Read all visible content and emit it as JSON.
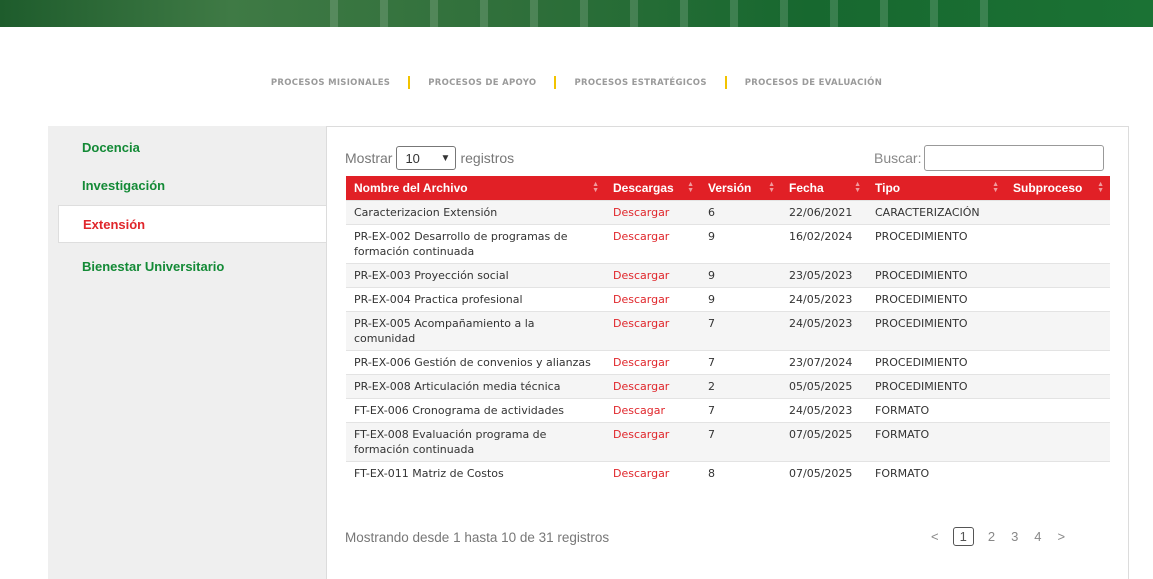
{
  "topnav": [
    "PROCESOS MISIONALES",
    "PROCESOS DE APOYO",
    "PROCESOS ESTRATÉGICOS",
    "PROCESOS DE EVALUACIÓN"
  ],
  "sidebar": {
    "items": [
      {
        "label": "Docencia",
        "active": false
      },
      {
        "label": "Investigación",
        "active": false
      },
      {
        "label": "Extensión",
        "active": true
      },
      {
        "label": "Bienestar Universitario",
        "active": false
      }
    ]
  },
  "controls": {
    "show_label": "Mostrar",
    "page_size": "10",
    "records_label": "registros",
    "search_label": "Buscar:",
    "search_value": ""
  },
  "table": {
    "headers": [
      "Nombre del Archivo",
      "Descargas",
      "Versión",
      "Fecha",
      "Tipo",
      "Subproceso"
    ],
    "rows": [
      [
        "Caracterizacion Extensión",
        "Descargar",
        "6",
        "22/06/2021",
        "CARACTERIZACIÓN",
        ""
      ],
      [
        "PR-EX-002 Desarrollo de programas de formación continuada",
        "Descargar",
        "9",
        "16/02/2024",
        "PROCEDIMIENTO",
        ""
      ],
      [
        "PR-EX-003 Proyección social",
        "Descargar",
        "9",
        "23/05/2023",
        "PROCEDIMIENTO",
        ""
      ],
      [
        "PR-EX-004 Practica profesional",
        "Descargar",
        "9",
        "24/05/2023",
        "PROCEDIMIENTO",
        ""
      ],
      [
        "PR-EX-005 Acompañamiento a la comunidad",
        "Descargar",
        "7",
        "24/05/2023",
        "PROCEDIMIENTO",
        ""
      ],
      [
        "PR-EX-006 Gestión de convenios y alianzas",
        "Descargar",
        "7",
        "23/07/2024",
        "PROCEDIMIENTO",
        ""
      ],
      [
        "PR-EX-008 Articulación media técnica",
        "Descargar",
        "2",
        "05/05/2025",
        "PROCEDIMIENTO",
        ""
      ],
      [
        "FT-EX-006 Cronograma de actividades",
        "Descagar",
        "7",
        "24/05/2023",
        "FORMATO",
        ""
      ],
      [
        "FT-EX-008 Evaluación programa de formación continuada",
        "Descargar",
        "7",
        "07/05/2025",
        "FORMATO",
        ""
      ],
      [
        "FT-EX-011 Matriz de Costos",
        "Descargar",
        "8",
        "07/05/2025",
        "FORMATO",
        ""
      ]
    ]
  },
  "footer": {
    "info": "Mostrando desde 1 hasta 10 de 31 registros",
    "prev": "<",
    "next": ">",
    "pages": [
      "1",
      "2",
      "3",
      "4"
    ],
    "current_page": "1"
  },
  "colors": {
    "accent_red": "#e12026",
    "green": "#138a36",
    "divider_yellow": "#f2c300"
  }
}
